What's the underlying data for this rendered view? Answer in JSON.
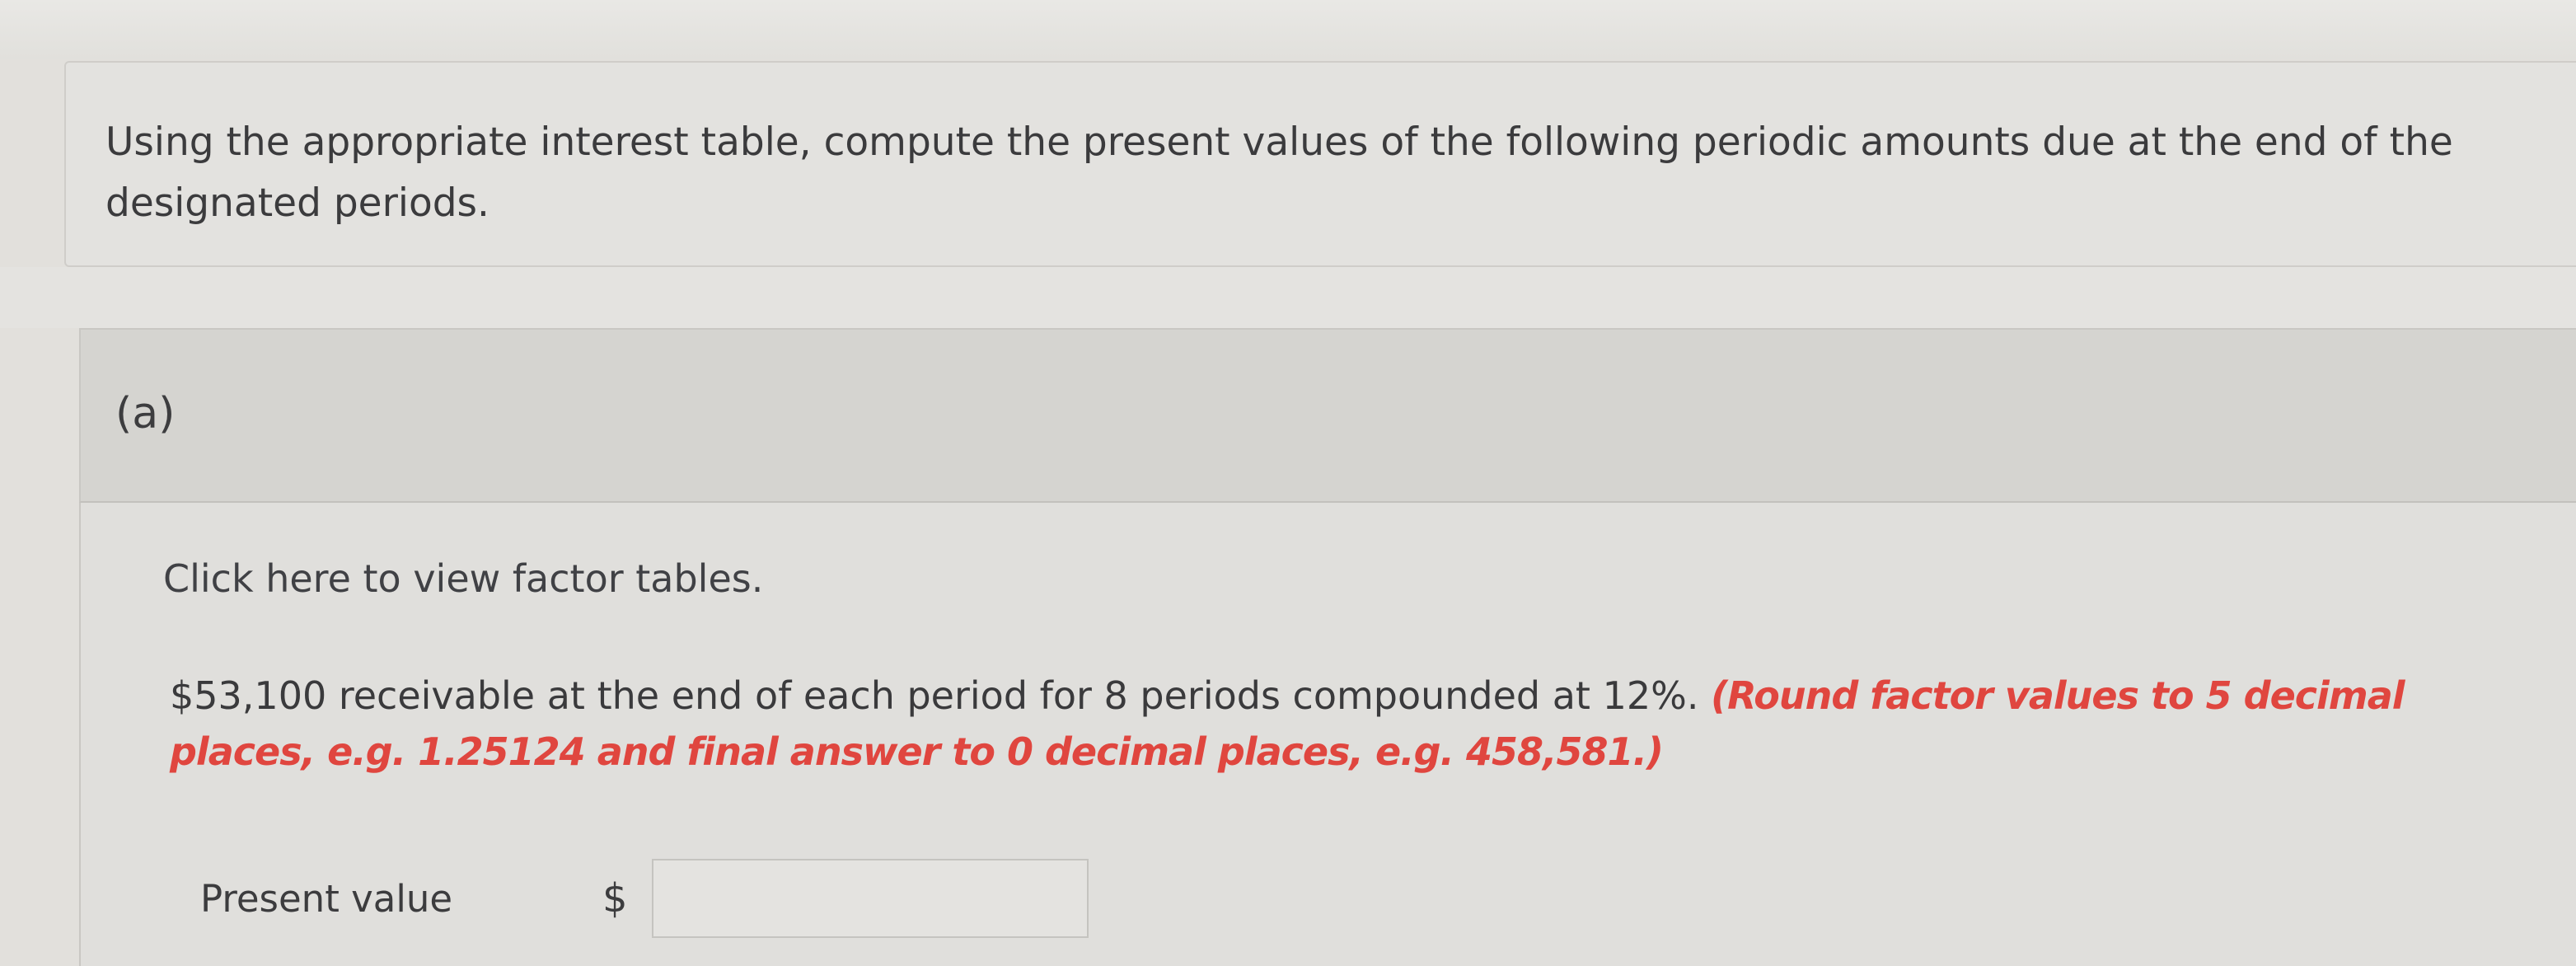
{
  "question": {
    "text": "Using the appropriate interest table, compute the present values of the following periodic amounts due at the end of the designated periods."
  },
  "part": {
    "label": "(a)",
    "factor_link": "Click here to view factor tables.",
    "statement": "$53,100 receivable at the end of each period for 8 periods compounded at 12%.",
    "rounding_note": "(Round factor values to 5 decimal places, e.g. 1.25124 and final answer to 0 decimal places, e.g. 458,581.)",
    "answer": {
      "label": "Present value",
      "currency_symbol": "$",
      "value": ""
    }
  },
  "colors": {
    "background": "#e2e0dc",
    "header_band": "#d5d4d0",
    "note_red": "#e0463f",
    "text": "#3a3a3c"
  }
}
